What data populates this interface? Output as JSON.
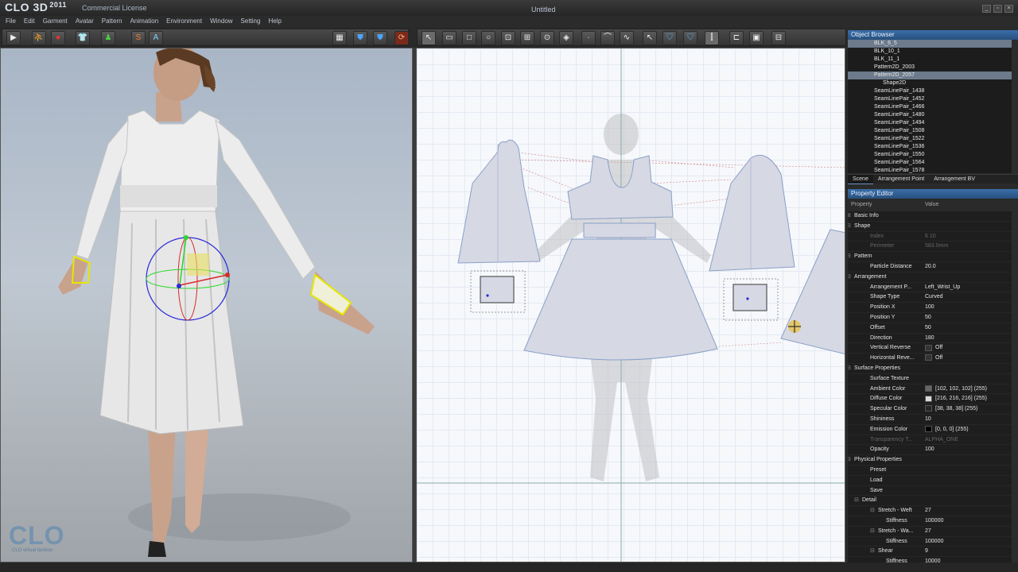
{
  "app": {
    "logo": "CLO 3D",
    "year": "2011",
    "license": "Commercial License",
    "title": "Untitled",
    "watermark": "CLO",
    "watermark_sub": "CLO virtual fashion"
  },
  "menu": [
    "File",
    "Edit",
    "Garment",
    "Avatar",
    "Pattern",
    "Animation",
    "Environment",
    "Window",
    "Setting",
    "Help"
  ],
  "toolbar_3d": {
    "icons": [
      "play-icon",
      "walk-icon",
      "record-icon",
      "garment-shirt-icon",
      "avatar-icon",
      "simulation-icon",
      "text-icon"
    ],
    "s_label": "S",
    "a_label": "A"
  },
  "object_browser": {
    "title": "Object Browser",
    "items": [
      {
        "label": "BLK_6_5",
        "indent": 3,
        "selected": true
      },
      {
        "label": "BLK_10_1",
        "indent": 3
      },
      {
        "label": "BLK_11_1",
        "indent": 3
      },
      {
        "label": "Pattern2D_2003",
        "indent": 3
      },
      {
        "label": "Pattern2D_2057",
        "indent": 3,
        "selected": true
      },
      {
        "label": "Shape2D",
        "indent": 4
      },
      {
        "label": "SeamLinePair_1438",
        "indent": 3
      },
      {
        "label": "SeamLinePair_1452",
        "indent": 3
      },
      {
        "label": "SeamLinePair_1466",
        "indent": 3
      },
      {
        "label": "SeamLinePair_1480",
        "indent": 3
      },
      {
        "label": "SeamLinePair_1494",
        "indent": 3
      },
      {
        "label": "SeamLinePair_1508",
        "indent": 3
      },
      {
        "label": "SeamLinePair_1522",
        "indent": 3
      },
      {
        "label": "SeamLinePair_1536",
        "indent": 3
      },
      {
        "label": "SeamLinePair_1550",
        "indent": 3
      },
      {
        "label": "SeamLinePair_1564",
        "indent": 3
      },
      {
        "label": "SeamLinePair_1578",
        "indent": 3
      }
    ],
    "tabs": [
      "Scene",
      "Arrangement Point",
      "Arrangement BV"
    ]
  },
  "property_editor": {
    "title": "Property Editor",
    "col_property": "Property",
    "col_value": "Value",
    "rows": [
      {
        "k": "Basic Info",
        "v": "",
        "lvl": 0,
        "type": "hdr",
        "sym": "+"
      },
      {
        "k": "Shape",
        "v": "",
        "lvl": 0,
        "type": "hdr",
        "sym": "-"
      },
      {
        "k": "Index",
        "v": "6 10",
        "lvl": 2,
        "type": "dim"
      },
      {
        "k": "Perimeter",
        "v": "583.0mm",
        "lvl": 2,
        "type": "dim"
      },
      {
        "k": "Pattern",
        "v": "",
        "lvl": 0,
        "type": "hdr",
        "sym": "-"
      },
      {
        "k": "Particle Distance",
        "v": "20.0",
        "lvl": 2
      },
      {
        "k": "Arrangement",
        "v": "",
        "lvl": 0,
        "type": "hdr",
        "sym": "-"
      },
      {
        "k": "Arrangement P...",
        "v": "Left_Wrist_Up",
        "lvl": 2
      },
      {
        "k": "Shape Type",
        "v": "Curved",
        "lvl": 2
      },
      {
        "k": "Position X",
        "v": "100",
        "lvl": 2
      },
      {
        "k": "Position Y",
        "v": "50",
        "lvl": 2
      },
      {
        "k": "Offset",
        "v": "50",
        "lvl": 2
      },
      {
        "k": "Direction",
        "v": "180",
        "lvl": 2
      },
      {
        "k": "Vertical Reverse",
        "v": "Off",
        "lvl": 2,
        "box": true
      },
      {
        "k": "Horizontal Reve...",
        "v": "Off",
        "lvl": 2,
        "box": true
      },
      {
        "k": "Surface Properties",
        "v": "",
        "lvl": 0,
        "type": "hdr",
        "sym": "-"
      },
      {
        "k": "Surface Texture",
        "v": "",
        "lvl": 2
      },
      {
        "k": "Ambient Color",
        "v": "[102, 102, 102] (255)",
        "lvl": 2,
        "color": "#666666"
      },
      {
        "k": "Diffuse Color",
        "v": "[216, 216, 216] (255)",
        "lvl": 2,
        "color": "#d8d8d8"
      },
      {
        "k": "Specular Color",
        "v": "[38, 38, 38] (255)",
        "lvl": 2,
        "color": "#262626"
      },
      {
        "k": "Shininess",
        "v": "10",
        "lvl": 2
      },
      {
        "k": "Emission Color",
        "v": "[0, 0, 0] (255)",
        "lvl": 2,
        "color": "#000000"
      },
      {
        "k": "Transparency T...",
        "v": "ALPHA_ONE",
        "lvl": 2,
        "type": "dim"
      },
      {
        "k": "Opacity",
        "v": "100",
        "lvl": 2
      },
      {
        "k": "Physical Properties",
        "v": "",
        "lvl": 0,
        "type": "hdr",
        "sym": "-"
      },
      {
        "k": "Preset",
        "v": "",
        "lvl": 2
      },
      {
        "k": "Load",
        "v": "",
        "lvl": 2
      },
      {
        "k": "Save",
        "v": "",
        "lvl": 2
      },
      {
        "k": "Detail",
        "v": "",
        "lvl": 1,
        "type": "hdr",
        "sym": "-"
      },
      {
        "k": "Stretch - Weft",
        "v": "27",
        "lvl": 3,
        "sym": "-"
      },
      {
        "k": "Stiffness",
        "v": "100000",
        "lvl": 4
      },
      {
        "k": "Stretch - Wa...",
        "v": "27",
        "lvl": 3,
        "sym": "-"
      },
      {
        "k": "Stiffness",
        "v": "100000",
        "lvl": 4
      },
      {
        "k": "Shear",
        "v": "9",
        "lvl": 3,
        "sym": "-"
      },
      {
        "k": "Stiffness",
        "v": "10000",
        "lvl": 4
      }
    ]
  }
}
